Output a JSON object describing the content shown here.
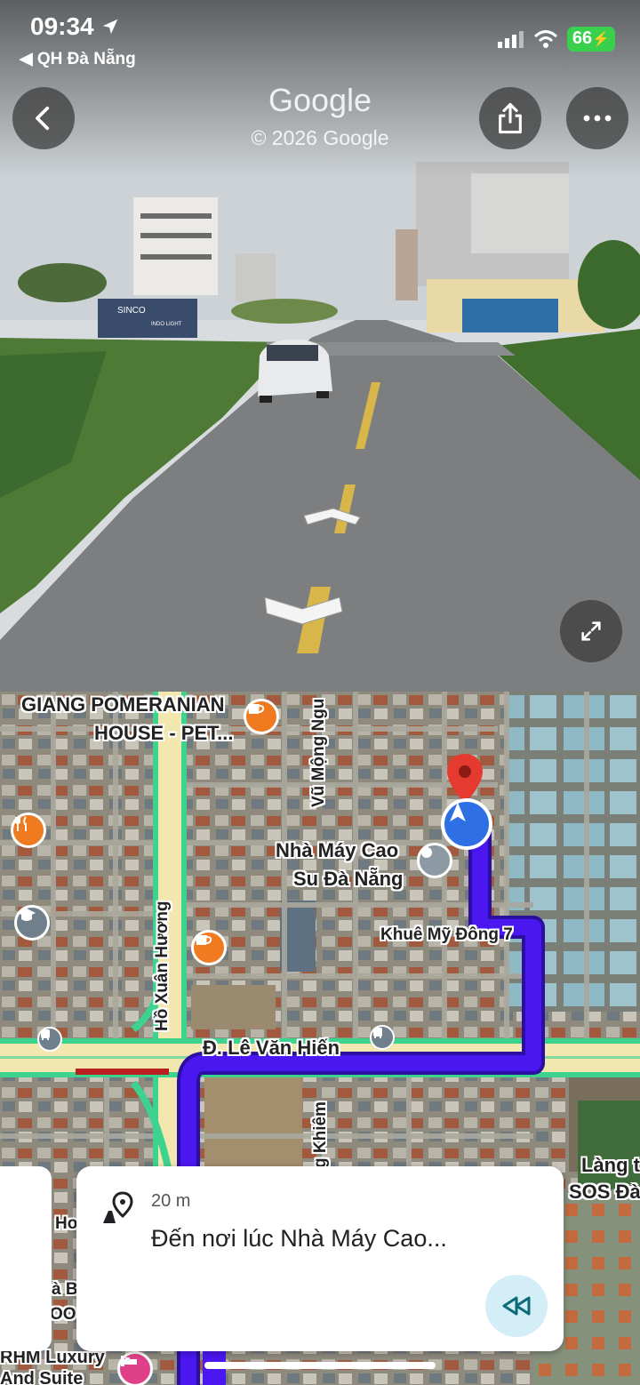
{
  "status_bar": {
    "time": "09:34",
    "back_app": "◀ QH Đà Nẵng",
    "battery": "66"
  },
  "street_view": {
    "logo": "Google",
    "copyright": "© 2026 Google",
    "sign_text": "SINCO",
    "sign_subtext": "INDO LIGHT",
    "back_icon": "chevron-left-icon",
    "share_icon": "share-icon",
    "more_icon": "more-icon",
    "expand_icon": "expand-icon"
  },
  "map": {
    "labels": {
      "pomeranian_1": "GIANG POMERANIAN",
      "pomeranian_2": "HOUSE - PET...",
      "vu_mong_ngu": "Vũ Mộng Ngu",
      "nha_may_1": "Nhà Máy Cao",
      "nha_may_2": "Su Đà Nẵng",
      "khue_my": "Khuê Mỹ Đông 7",
      "ho_xuan_huong": "Hồ Xuân Hương",
      "le_van_hien": "Đ. Lê Văn Hiến",
      "khiem": "g Khiêm",
      "lang_1": "Làng t",
      "lang_2": "SOS Đà",
      "left_ho": "Ho",
      "left_a": "à B",
      "left_oo": "OO",
      "rhm_1": "RHM Luxury",
      "rhm_2": "And Suite"
    },
    "colors": {
      "route": "#4a17f0",
      "road_edge": "#3ed28f",
      "road_fill": "#f3e7b0",
      "traffic_red": "#b92020"
    }
  },
  "nav_card": {
    "distance": "20 m",
    "instruction": "Đến nơi lúc Nhà Máy Cao...",
    "rewind_icon": "rewind-icon",
    "destination_icon": "destination-pin-icon"
  }
}
